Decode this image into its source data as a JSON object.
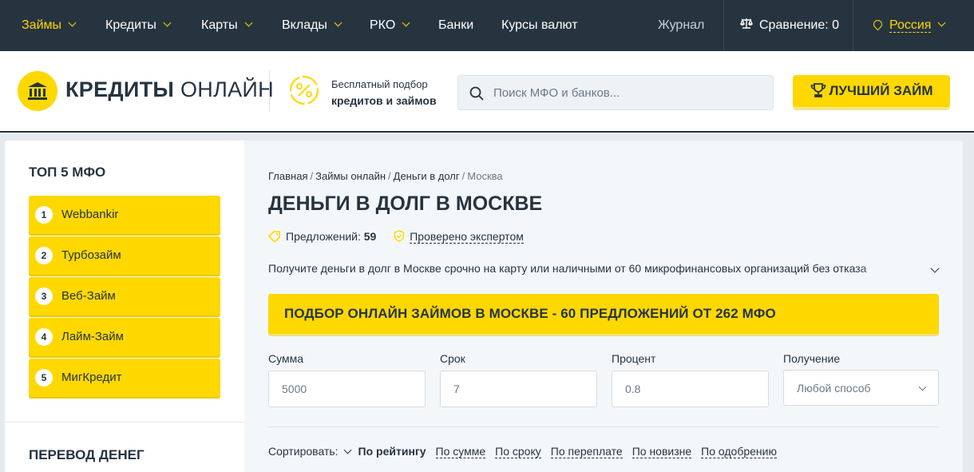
{
  "topnav": {
    "items": [
      {
        "label": "Займы",
        "active": true,
        "dropdown": true
      },
      {
        "label": "Кредиты",
        "dropdown": true
      },
      {
        "label": "Карты",
        "dropdown": true
      },
      {
        "label": "Вклады",
        "dropdown": true
      },
      {
        "label": "РКО",
        "dropdown": true
      },
      {
        "label": "Банки",
        "dropdown": false
      },
      {
        "label": "Курсы валют",
        "dropdown": false
      }
    ],
    "journal": "Журнал",
    "compare": "Сравнение: 0",
    "region": "Россия"
  },
  "header": {
    "logo_bold": "КРЕДИТЫ",
    "logo_light": "ОНЛАЙН",
    "pick_line1": "Бесплатный подбор",
    "pick_line2": "кредитов и займов",
    "search_placeholder": "Поиск МФО и банков...",
    "best_loan": "ЛУЧШИЙ ЗАЙМ"
  },
  "sidebar": {
    "title": "ТОП 5 МФО",
    "items": [
      {
        "num": "1",
        "name": "Webbankir"
      },
      {
        "num": "2",
        "name": "Турбозайм"
      },
      {
        "num": "3",
        "name": "Веб-Займ"
      },
      {
        "num": "4",
        "name": "Лайм-Займ"
      },
      {
        "num": "5",
        "name": "МигКредит"
      }
    ],
    "title2": "ПЕРЕВОД ДЕНЕГ"
  },
  "main": {
    "breadcrumb": [
      "Главная",
      "Займы онлайн",
      "Деньги в долг",
      "Москва"
    ],
    "title": "ДЕНЬГИ В ДОЛГ В МОСКВЕ",
    "offers_label": "Предложений:",
    "offers_count": "59",
    "checked": "Проверено экспертом",
    "description": "Получите деньги в долг в Москве срочно на карту или наличными от 60 микрофинансовых организаций без отказа",
    "banner": "ПОДБОР ОНЛАЙН ЗАЙМОВ В МОСКВЕ - 60 ПРЕДЛОЖЕНИЙ ОТ 262 МФО",
    "filters": {
      "sum_label": "Сумма",
      "sum_value": "5000",
      "term_label": "Срок",
      "term_value": "7",
      "rate_label": "Процент",
      "rate_value": "0.8",
      "receive_label": "Получение",
      "receive_value": "Любой способ"
    },
    "sort_label": "Сортировать:",
    "sort_options": [
      "По рейтингу",
      "По сумме",
      "По сроку",
      "По переплате",
      "По новизне",
      "По одобрению"
    ]
  },
  "colors": {
    "accent": "#ffd800",
    "nav_bg": "#263440",
    "text": "#263440"
  }
}
